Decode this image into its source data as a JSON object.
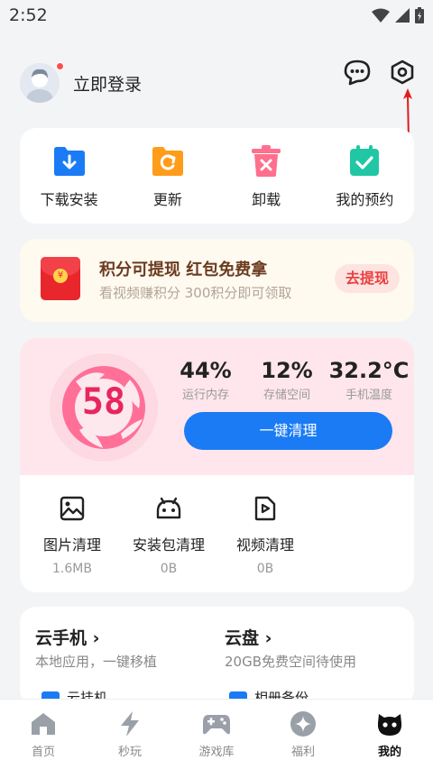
{
  "status": {
    "time": "2:52"
  },
  "header": {
    "login_label": "立即登录"
  },
  "quick_actions": [
    {
      "label": "下载安装",
      "icon": "download-folder-icon",
      "color": "#1a7bf5"
    },
    {
      "label": "更新",
      "icon": "update-folder-icon",
      "color": "#ff9c1a"
    },
    {
      "label": "卸载",
      "icon": "trash-icon",
      "color": "#ff6f8e"
    },
    {
      "label": "我的预约",
      "icon": "calendar-check-icon",
      "color": "#21c7a4"
    }
  ],
  "promo": {
    "title": "积分可提现 红包免费拿",
    "subtitle": "看视频赚积分 300积分即可领取",
    "button": "去提现",
    "coin_symbol": "¥"
  },
  "cleaner": {
    "score": "58",
    "stats": [
      {
        "value": "44%",
        "label": "运行内存"
      },
      {
        "value": "12%",
        "label": "存储空间"
      },
      {
        "value": "32.2°C",
        "label": "手机温度"
      }
    ],
    "button": "一键清理",
    "items": [
      {
        "label": "图片清理",
        "size": "1.6MB",
        "icon": "image-icon"
      },
      {
        "label": "安装包清理",
        "size": "0B",
        "icon": "android-icon"
      },
      {
        "label": "视频清理",
        "size": "0B",
        "icon": "video-file-icon"
      }
    ]
  },
  "cloud": {
    "phone_title": "云手机 ›",
    "phone_sub": "本地应用，一键移植",
    "disk_title": "云盘 ›",
    "disk_sub": "20GB免费空间待使用",
    "row_left": "云挂机",
    "row_right": "相册备份"
  },
  "tabs": [
    {
      "label": "首页",
      "icon": "home-icon",
      "active": false
    },
    {
      "label": "秒玩",
      "icon": "lightning-icon",
      "active": false
    },
    {
      "label": "游戏库",
      "icon": "gamepad-icon",
      "active": false
    },
    {
      "label": "福利",
      "icon": "star-badge-icon",
      "active": false
    },
    {
      "label": "我的",
      "icon": "mascot-icon",
      "active": true
    }
  ],
  "colors": {
    "accent": "#1a7bf5",
    "pink": "#e8265e",
    "promo_red": "#e84141"
  }
}
